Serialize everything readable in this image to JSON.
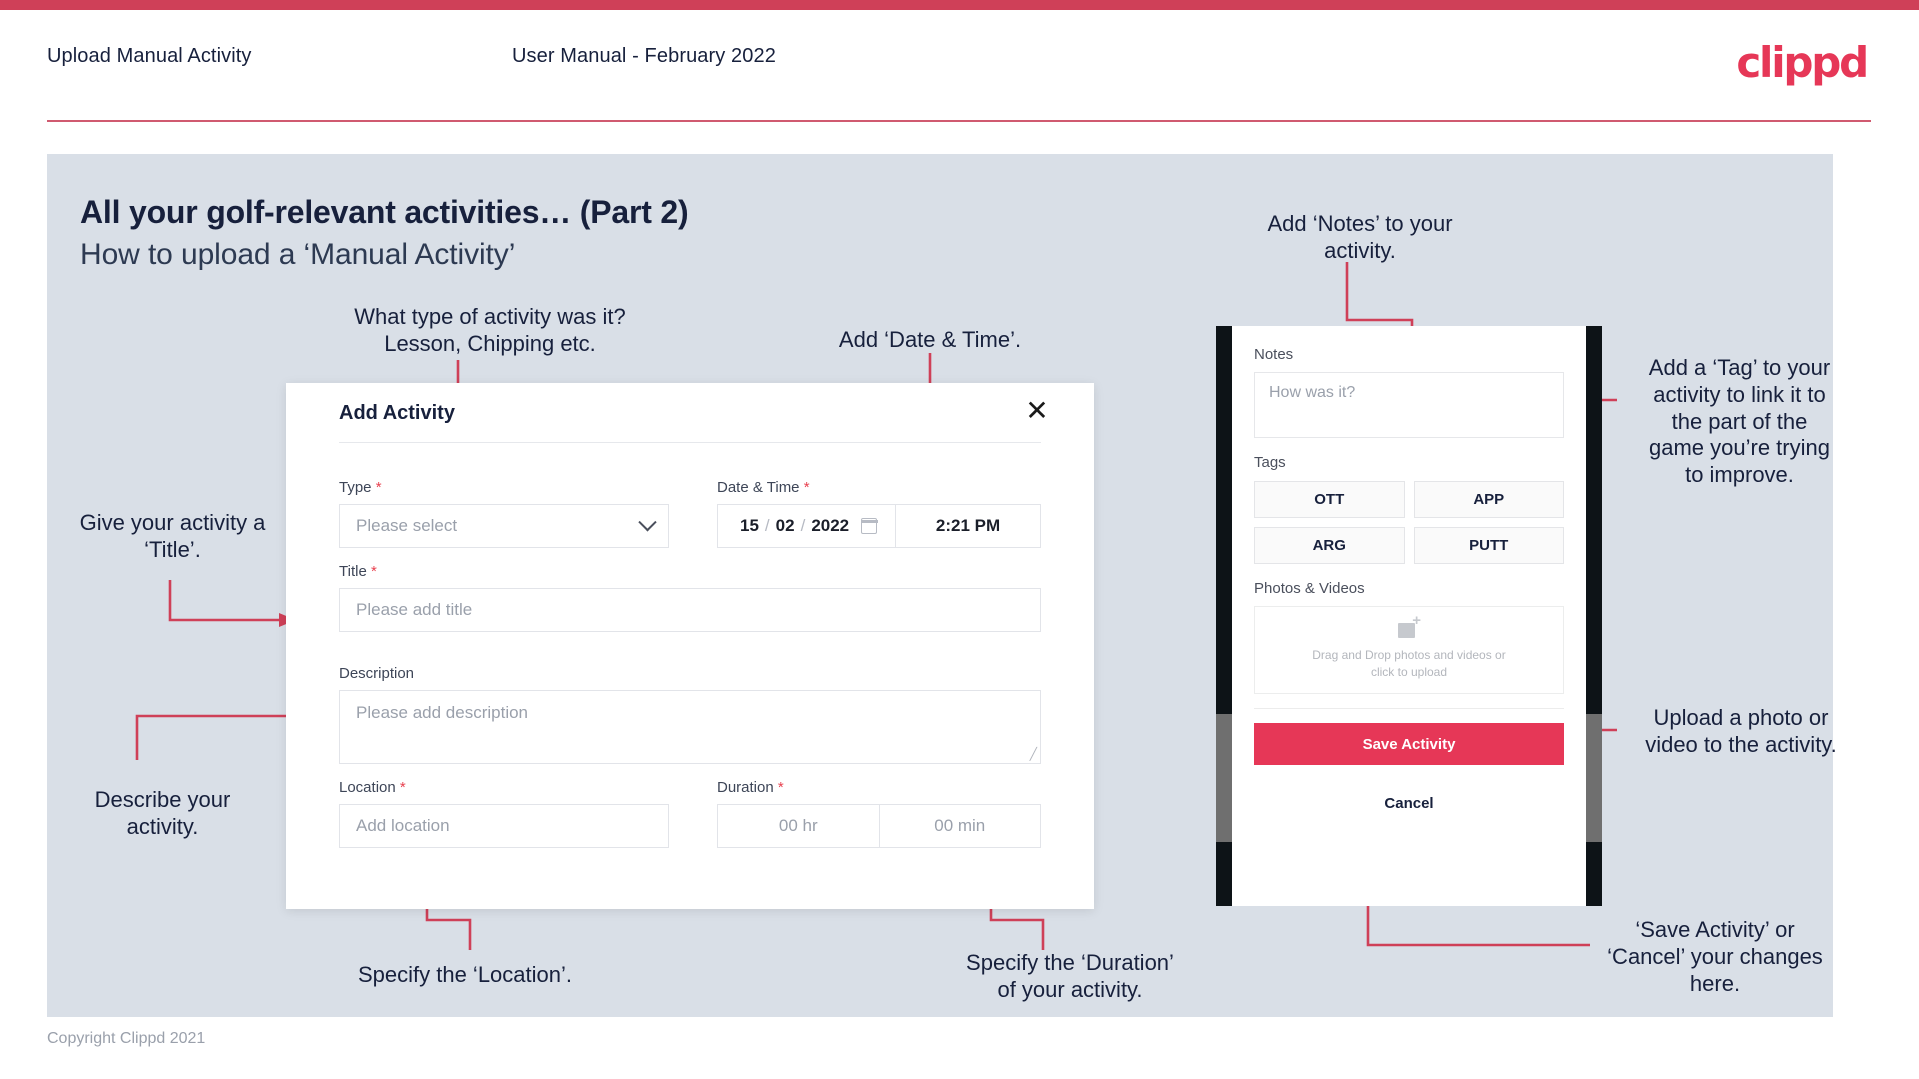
{
  "header": {
    "title": "Upload Manual Activity",
    "subtitle": "User Manual - February 2022",
    "logo": "clippd",
    "accent_color": "#e63757",
    "bar_color": "#cf4058"
  },
  "slide": {
    "title": "All your golf-relevant activities… (Part 2)",
    "subtitle": "How to upload a ‘Manual Activity’",
    "background": "#d9dfe7"
  },
  "annotations": {
    "type": "What type of activity was it?\nLesson, Chipping etc.",
    "datetime": "Add ‘Date & Time’.",
    "title": "Give your activity a\n‘Title’.",
    "description": "Describe your\nactivity.",
    "location": "Specify the ‘Location’.",
    "duration": "Specify the ‘Duration’\nof your activity.",
    "notes": "Add ‘Notes’ to your\nactivity.",
    "tags": "Add a ‘Tag’ to your\nactivity to link it to\nthe part of the\ngame you’re trying\nto improve.",
    "photos": "Upload a photo or\nvideo to the activity.",
    "save": "‘Save Activity’ or\n‘Cancel’ your changes\nhere."
  },
  "modal": {
    "title": "Add Activity",
    "close_icon": "close-icon",
    "fields": {
      "type": {
        "label": "Type",
        "required": true,
        "placeholder": "Please select",
        "icon": "chevron-down-icon"
      },
      "datetime": {
        "label": "Date & Time",
        "required": true,
        "day": "15",
        "month": "02",
        "year": "2022",
        "separator": "/",
        "time": "2:21 PM",
        "icon": "calendar-icon"
      },
      "title": {
        "label": "Title",
        "required": true,
        "placeholder": "Please add title"
      },
      "description": {
        "label": "Description",
        "required": false,
        "placeholder": "Please add description"
      },
      "location": {
        "label": "Location",
        "required": true,
        "placeholder": "Add location"
      },
      "duration": {
        "label": "Duration",
        "required": true,
        "hours": "00 hr",
        "minutes": "00 min"
      }
    }
  },
  "phone": {
    "notes": {
      "label": "Notes",
      "placeholder": "How was it?"
    },
    "tags": {
      "label": "Tags",
      "options": [
        "OTT",
        "APP",
        "ARG",
        "PUTT"
      ]
    },
    "photos": {
      "label": "Photos & Videos",
      "dropzone_line1": "Drag and Drop photos and videos or",
      "dropzone_line2": "click to upload",
      "icon": "add-image-icon"
    },
    "save_label": "Save Activity",
    "cancel_label": "Cancel"
  },
  "footer": {
    "copyright": "Copyright Clippd 2021"
  }
}
